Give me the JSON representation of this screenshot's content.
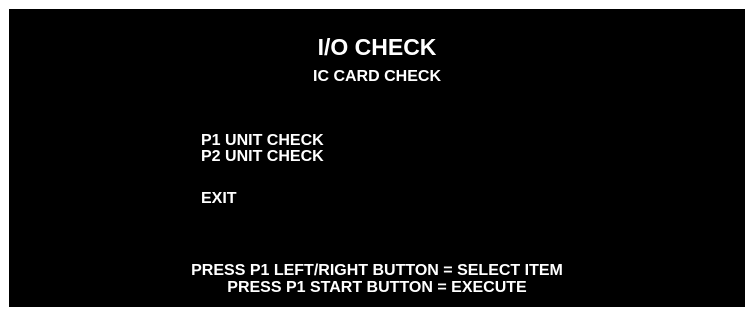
{
  "header": {
    "title": "I/O CHECK",
    "subtitle": "IC CARD CHECK"
  },
  "menu": {
    "items": [
      {
        "label": "P1 UNIT CHECK"
      },
      {
        "label": "P2 UNIT CHECK"
      },
      {
        "label": "EXIT"
      }
    ]
  },
  "footer": {
    "line1": "PRESS P1 LEFT/RIGHT BUTTON = SELECT ITEM",
    "line2": "PRESS P1 START BUTTON = EXECUTE"
  },
  "colors": {
    "background": "#000000",
    "text": "#ffffff"
  }
}
